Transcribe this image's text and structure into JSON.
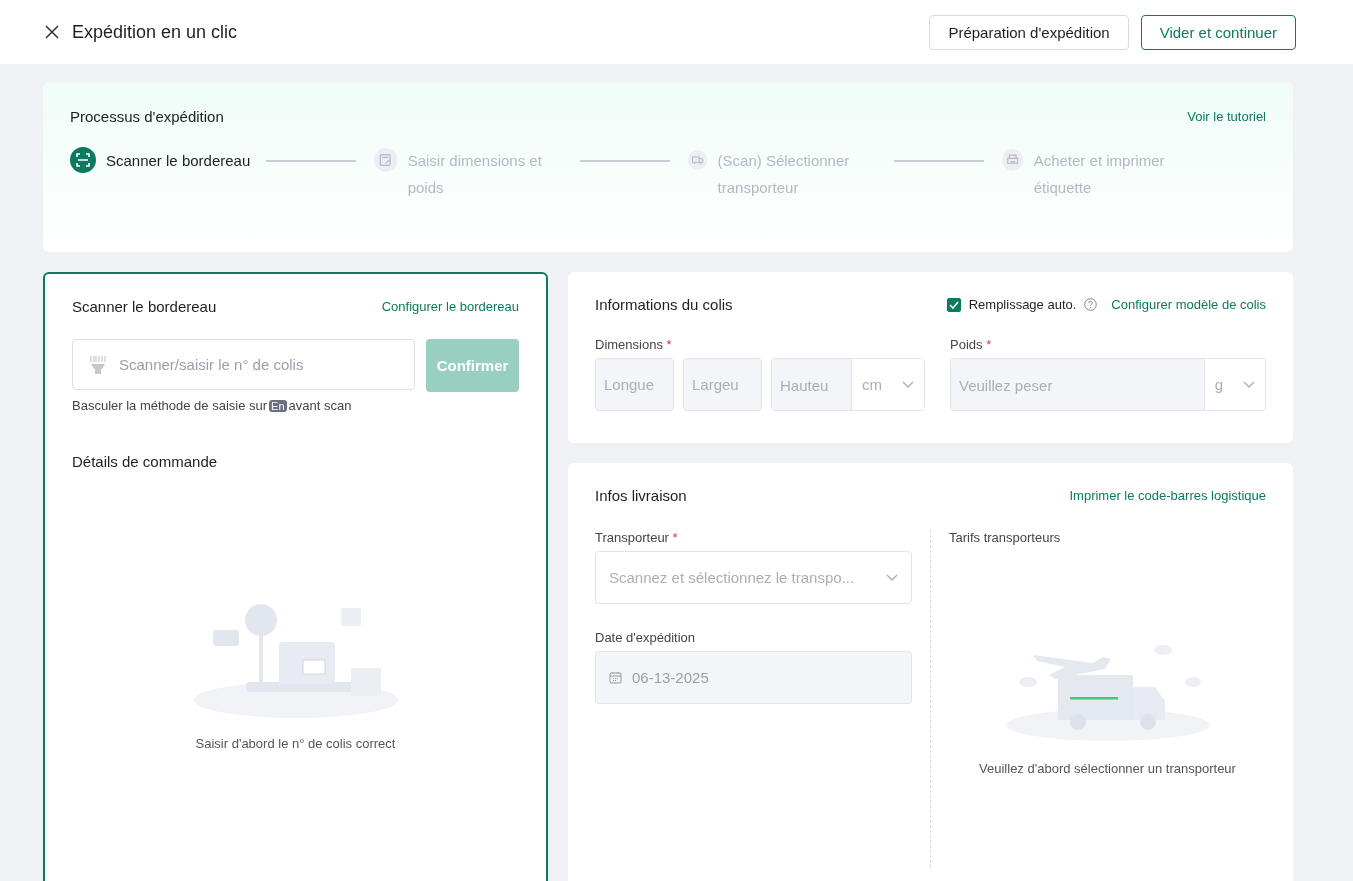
{
  "header": {
    "title": "Expédition en un clic",
    "buttons": [
      {
        "label": "Préparation d'expédition",
        "kind": "default"
      },
      {
        "label": "Vider et continuer",
        "kind": "outline"
      }
    ]
  },
  "process": {
    "title": "Processus d'expédition",
    "link": "Voir le tutoriel",
    "steps": [
      {
        "label": "Scanner le bordereau",
        "active": true
      },
      {
        "label": "Saisir dimensions et poids",
        "active": false
      },
      {
        "label": "(Scan) Sélectionner transporteur",
        "active": false
      },
      {
        "label": "Acheter et imprimer étiquette",
        "active": false
      }
    ]
  },
  "scan_panel": {
    "title": "Scanner le bordereau",
    "link": "Configurer le bordereau",
    "input_placeholder": "Scanner/saisir le n° de colis",
    "confirm": "Confirmer",
    "confirm_disabled": true,
    "hint_before": "Basculer la méthode de saisie sur",
    "hint_key": "En",
    "hint_after": "avant scan",
    "details_title": "Détails de commande",
    "empty_text": "Saisir d'abord le n° de colis correct"
  },
  "parcel": {
    "title": "Informations du colis",
    "auto_fill": {
      "label": "Remplissage auto.",
      "checked": true
    },
    "link": "Configurer modèle de colis",
    "dimensions_label": "Dimensions",
    "dimensions_required_mark": "*",
    "dimension_placeholders": [
      "Longue",
      "Largeu",
      "Hauteu"
    ],
    "dimension_unit": "cm",
    "weight_label": "Poids",
    "weight_required_mark": "*",
    "weight_placeholder": "Veuillez peser",
    "weight_unit": "g"
  },
  "delivery": {
    "title": "Infos livraison",
    "link": "Imprimer le code-barres logistique",
    "carrier_label": "Transporteur",
    "carrier_required_mark": "*",
    "carrier_placeholder": "Scannez et sélectionnez le transpo...",
    "date_label": "Date d'expédition",
    "date_value": "06-13-2025",
    "rates_title": "Tarifs transporteurs",
    "rates_empty": "Veuillez d'abord sélectionner un transporteur"
  }
}
